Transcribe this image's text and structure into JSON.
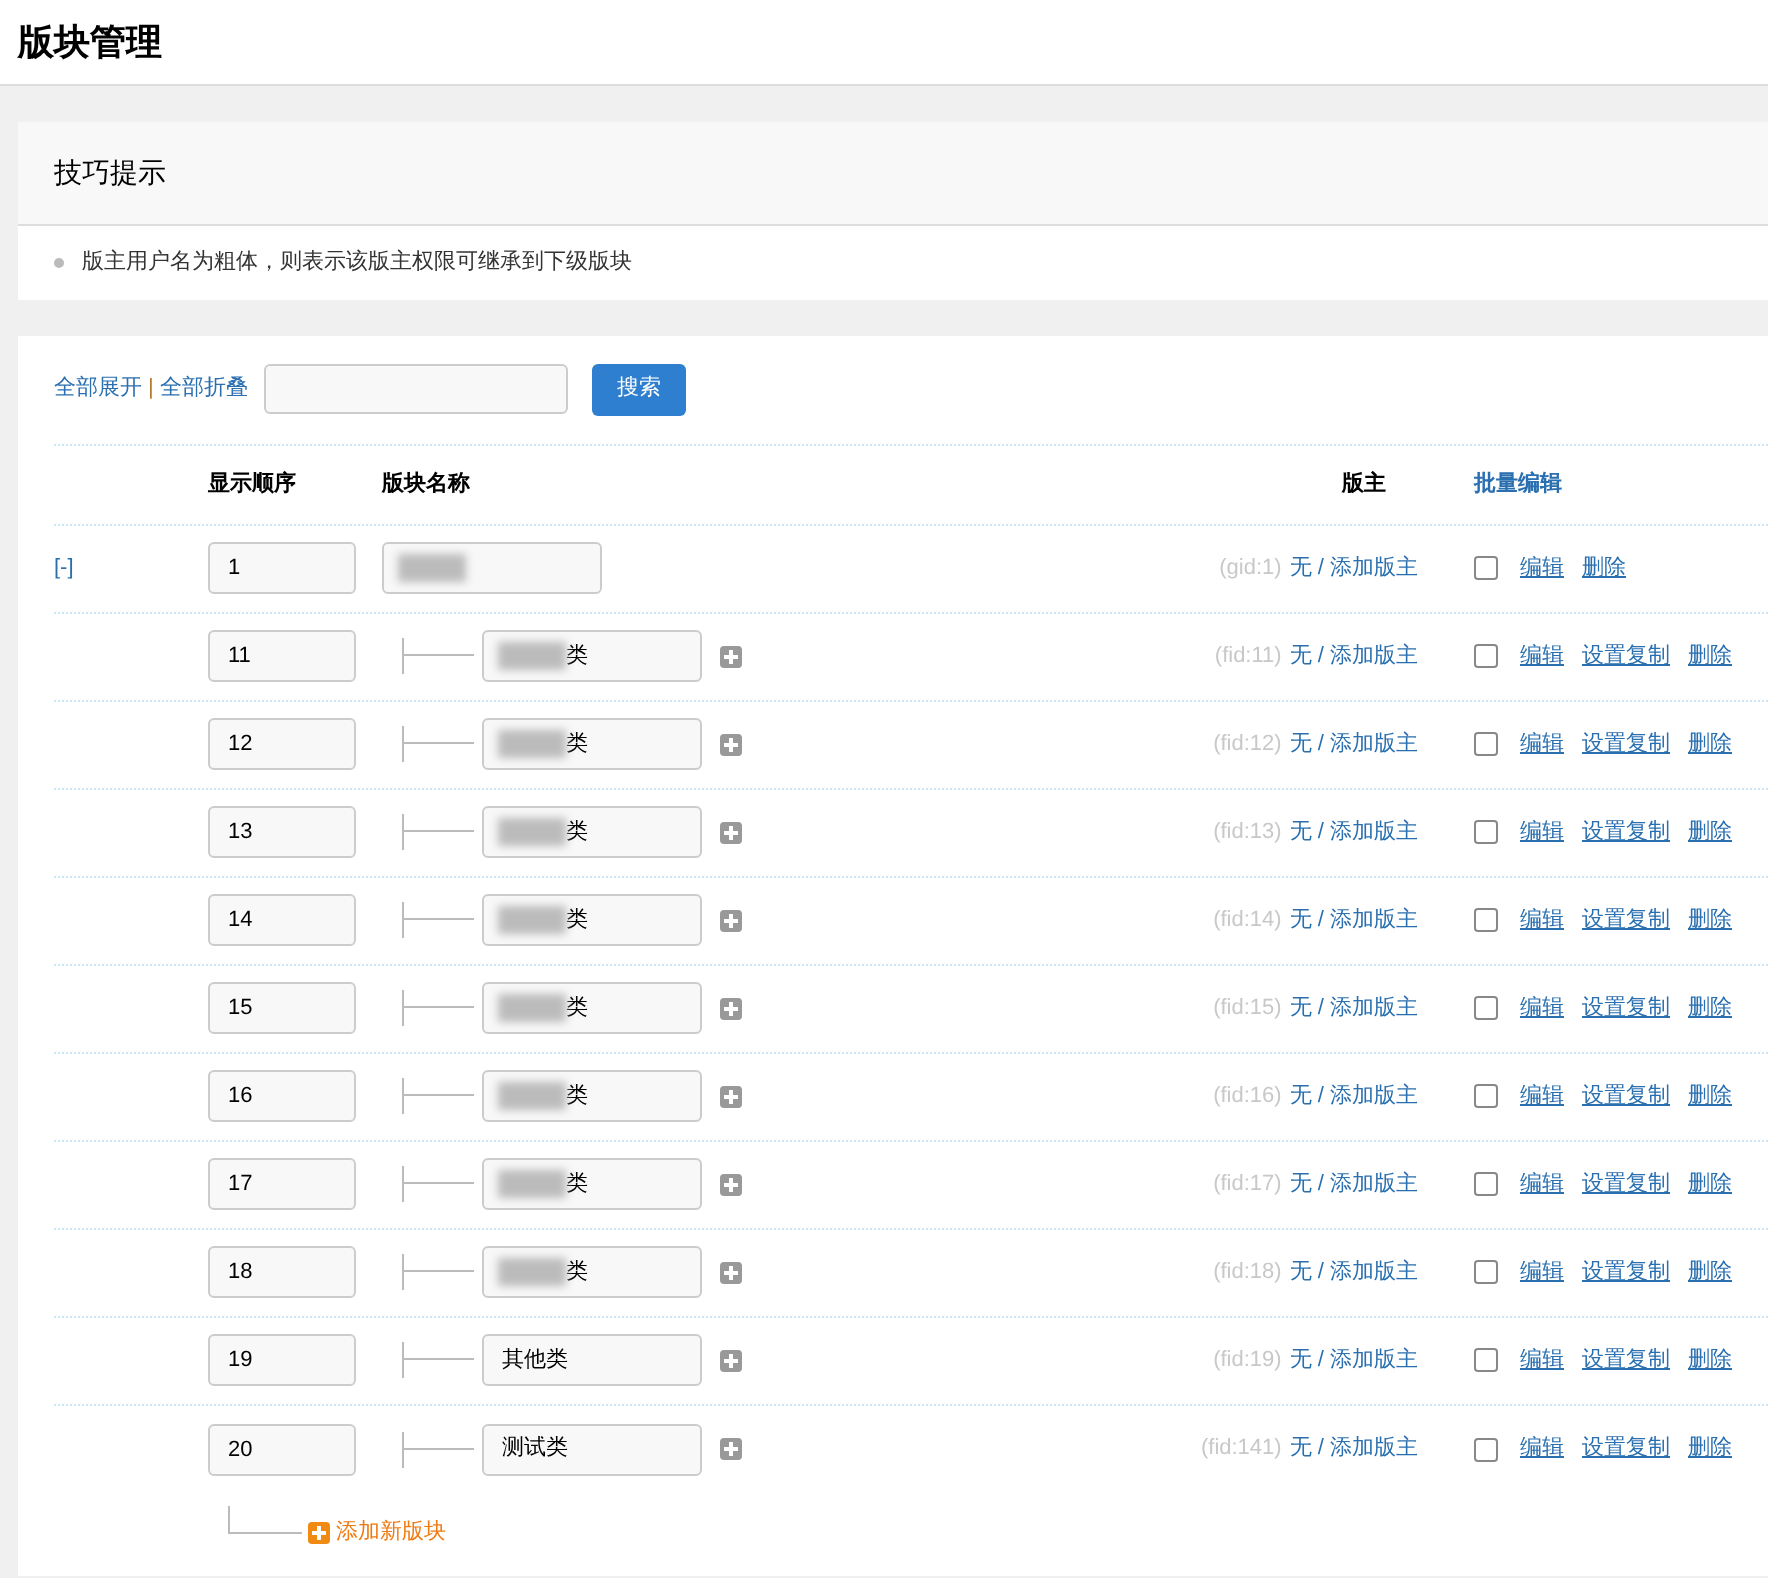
{
  "page_title": "版块管理",
  "tips": {
    "title": "技巧提示",
    "items": [
      "版主用户名为粗体，则表示该版主权限可继承到下级版块"
    ]
  },
  "toolbar": {
    "expand_all": "全部展开",
    "separator": "|",
    "collapse_all": "全部折叠",
    "search_button": "搜索"
  },
  "columns": {
    "order": "显示顺序",
    "name": "版块名称",
    "moderator": "版主",
    "batch_edit": "批量编辑"
  },
  "rows": [
    {
      "kind": "group",
      "toggle": "[-]",
      "order": "1",
      "name": "",
      "redacted": true,
      "id": "(gid:1)",
      "moderator": "无 / 添加版主",
      "checked": false,
      "actions": [
        "编辑",
        "删除"
      ]
    },
    {
      "kind": "forum",
      "order": "11",
      "name": "类",
      "redacted": true,
      "id": "(fid:11)",
      "moderator": "无 / 添加版主",
      "checked": false,
      "actions": [
        "编辑",
        "设置复制",
        "删除"
      ]
    },
    {
      "kind": "forum",
      "order": "12",
      "name": "类",
      "redacted": true,
      "id": "(fid:12)",
      "moderator": "无 / 添加版主",
      "checked": false,
      "actions": [
        "编辑",
        "设置复制",
        "删除"
      ]
    },
    {
      "kind": "forum",
      "order": "13",
      "name": "类",
      "redacted": true,
      "id": "(fid:13)",
      "moderator": "无 / 添加版主",
      "checked": false,
      "actions": [
        "编辑",
        "设置复制",
        "删除"
      ]
    },
    {
      "kind": "forum",
      "order": "14",
      "name": "类",
      "redacted": true,
      "id": "(fid:14)",
      "moderator": "无 / 添加版主",
      "checked": false,
      "actions": [
        "编辑",
        "设置复制",
        "删除"
      ]
    },
    {
      "kind": "forum",
      "order": "15",
      "name": "类",
      "redacted": true,
      "id": "(fid:15)",
      "moderator": "无 / 添加版主",
      "checked": false,
      "actions": [
        "编辑",
        "设置复制",
        "删除"
      ]
    },
    {
      "kind": "forum",
      "order": "16",
      "name": "类",
      "redacted": true,
      "id": "(fid:16)",
      "moderator": "无 / 添加版主",
      "checked": false,
      "actions": [
        "编辑",
        "设置复制",
        "删除"
      ]
    },
    {
      "kind": "forum",
      "order": "17",
      "name": "类",
      "redacted": true,
      "id": "(fid:17)",
      "moderator": "无 / 添加版主",
      "checked": false,
      "actions": [
        "编辑",
        "设置复制",
        "删除"
      ]
    },
    {
      "kind": "forum",
      "order": "18",
      "name": "类",
      "redacted": true,
      "id": "(fid:18)",
      "moderator": "无 / 添加版主",
      "checked": false,
      "actions": [
        "编辑",
        "设置复制",
        "删除"
      ]
    },
    {
      "kind": "forum",
      "order": "19",
      "name": "其他类",
      "redacted": false,
      "id": "(fid:19)",
      "moderator": "无 / 添加版主",
      "checked": false,
      "actions": [
        "编辑",
        "设置复制",
        "删除"
      ]
    },
    {
      "kind": "forum",
      "order": "20",
      "name": "测试类",
      "redacted": false,
      "id": "(fid:141)",
      "moderator": "无 / 添加版主",
      "checked": false,
      "actions": [
        "编辑",
        "设置复制",
        "删除"
      ]
    }
  ],
  "add_forum": "添加新版块"
}
